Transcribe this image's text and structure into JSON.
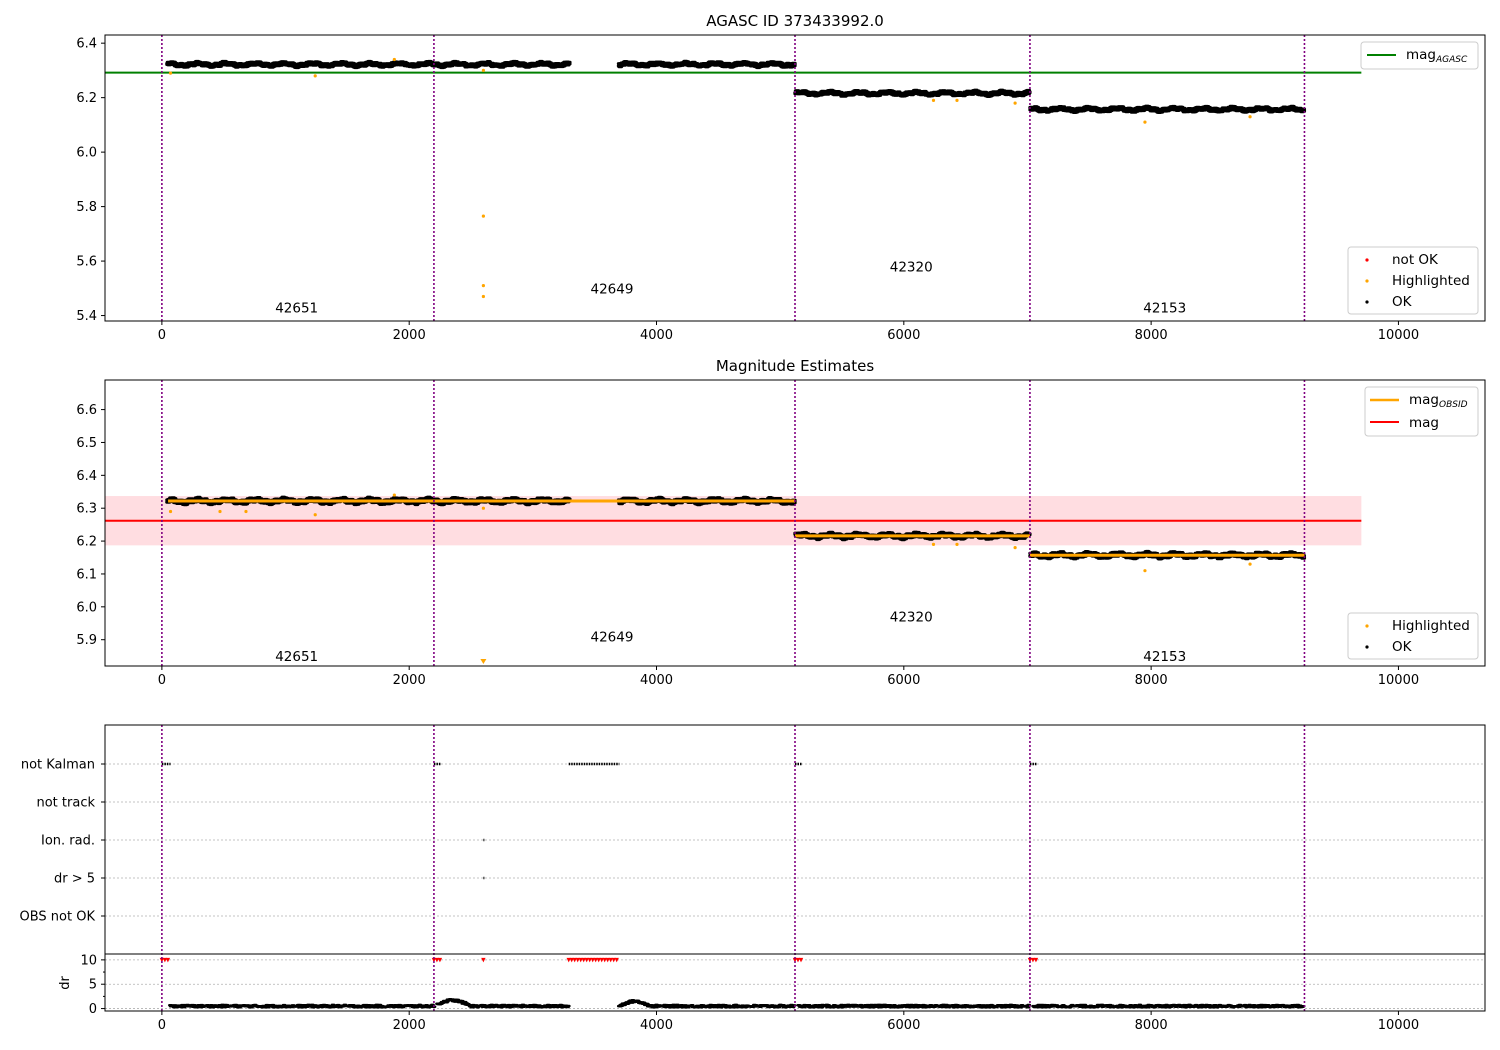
{
  "colors": {
    "ok": "#000000",
    "highlighted": "#ffa500",
    "not_ok": "#ff0000",
    "mag_agasc": "#008000",
    "mag": "#ff0000",
    "mag_obsid": "#ffa500",
    "boundary": "#800080",
    "band": "#ffdde1"
  },
  "chart_data": [
    {
      "type": "scatter",
      "title": "AGASC ID 373433992.0",
      "xlim": [
        -460,
        10700
      ],
      "ylim": [
        5.38,
        6.43
      ],
      "xticks": [
        "0",
        "2000",
        "4000",
        "6000",
        "8000",
        "10000"
      ],
      "yticks": [
        "5.4",
        "5.6",
        "5.8",
        "6.0",
        "6.2",
        "6.4"
      ],
      "obsid_boundaries": [
        0,
        2200,
        5120,
        7020,
        9240
      ],
      "obsids": [
        {
          "label": "42651",
          "x": 1090,
          "y": 5.43,
          "range": [
            50,
            2200
          ],
          "level": 6.322
        },
        {
          "label": "42649",
          "x": 3640,
          "y": 5.5,
          "range": [
            2210,
            5110
          ],
          "level": 6.322,
          "gap": [
            3290,
            3700
          ]
        },
        {
          "label": "42320",
          "x": 6060,
          "y": 5.58,
          "range": [
            5130,
            7010
          ],
          "level": 6.216
        },
        {
          "label": "42153",
          "x": 8110,
          "y": 5.43,
          "range": [
            7030,
            9230
          ],
          "level": 6.157
        }
      ],
      "lines": [
        {
          "name": "mag_AGASC",
          "y": 6.292,
          "x": [
            -460,
            9700
          ]
        }
      ],
      "highlighted": [
        [
          70,
          6.29
        ],
        [
          1240,
          6.28
        ],
        [
          1880,
          6.34
        ],
        [
          2600,
          6.3
        ],
        [
          2600,
          5.765
        ],
        [
          2600,
          5.51
        ],
        [
          2600,
          5.47
        ],
        [
          6240,
          6.19
        ],
        [
          6430,
          6.19
        ],
        [
          6900,
          6.18
        ],
        [
          7950,
          6.11
        ],
        [
          8800,
          6.13
        ]
      ],
      "legend_top": [
        {
          "label": "mag",
          "sub": "AGASC",
          "color": "#008000"
        }
      ],
      "legend_bottom": [
        "not OK",
        "Highlighted",
        "OK"
      ]
    },
    {
      "type": "scatter",
      "title": "Magnitude Estimates",
      "xlim": [
        -460,
        10700
      ],
      "ylim": [
        5.82,
        6.69
      ],
      "xticks": [
        "0",
        "2000",
        "4000",
        "6000",
        "8000",
        "10000"
      ],
      "yticks": [
        "5.9",
        "6.0",
        "6.1",
        "6.2",
        "6.3",
        "6.4",
        "6.5",
        "6.6"
      ],
      "obsids": [
        {
          "label": "42651",
          "x": 1090,
          "y": 5.85
        },
        {
          "label": "42649",
          "x": 3640,
          "y": 5.91
        },
        {
          "label": "42320",
          "x": 6060,
          "y": 5.97
        },
        {
          "label": "42153",
          "x": 8110,
          "y": 5.85
        }
      ],
      "mag_mean": 6.262,
      "mag_band": [
        6.187,
        6.337
      ],
      "mag_obsid": [
        {
          "range": [
            50,
            5120
          ],
          "value": 6.322
        },
        {
          "range": [
            5120,
            7020
          ],
          "value": 6.216
        },
        {
          "range": [
            7020,
            9240
          ],
          "value": 6.157
        }
      ],
      "highlighted": [
        [
          70,
          6.29
        ],
        [
          470,
          6.29
        ],
        [
          680,
          6.29
        ],
        [
          1240,
          6.28
        ],
        [
          1880,
          6.34
        ],
        [
          2600,
          6.3
        ],
        [
          2600,
          5.83
        ],
        [
          6240,
          6.19
        ],
        [
          6430,
          6.19
        ],
        [
          6900,
          6.18
        ],
        [
          7950,
          6.11
        ],
        [
          8800,
          6.13
        ]
      ],
      "legend_top": [
        {
          "label": "mag",
          "sub": "OBSID",
          "color": "#ffa500"
        },
        {
          "label": "mag",
          "sub": "",
          "color": "#ff0000"
        }
      ],
      "legend_bottom": [
        "Highlighted",
        "OK"
      ]
    },
    {
      "type": "scatter",
      "title": "",
      "flag_rows": [
        "not Kalman",
        "not track",
        "Ion. rad.",
        "dr > 5",
        "OBS not OK"
      ],
      "flags": {
        "not Kalman": [
          [
            0,
            70
          ],
          [
            2200,
            2260
          ],
          [
            3290,
            3700
          ],
          [
            5120,
            5180
          ],
          [
            7020,
            7080
          ]
        ],
        "Ion. rad.": [
          [
            2600,
            2600
          ]
        ],
        "dr > 5": [
          [
            2600,
            2600
          ]
        ]
      },
      "dr_label": "dr",
      "dr_ylim": [
        -0.5,
        11
      ],
      "dr_yticks": [
        "0",
        "5",
        "10"
      ],
      "dr_clipped": [
        [
          0,
          70
        ],
        [
          2200,
          2260
        ],
        [
          2600,
          2600
        ],
        [
          3290,
          3700
        ],
        [
          5120,
          5180
        ],
        [
          7020,
          7080
        ]
      ],
      "xlim": [
        -460,
        10700
      ],
      "xticks": [
        "0",
        "2000",
        "4000",
        "6000",
        "8000",
        "10000"
      ]
    }
  ]
}
